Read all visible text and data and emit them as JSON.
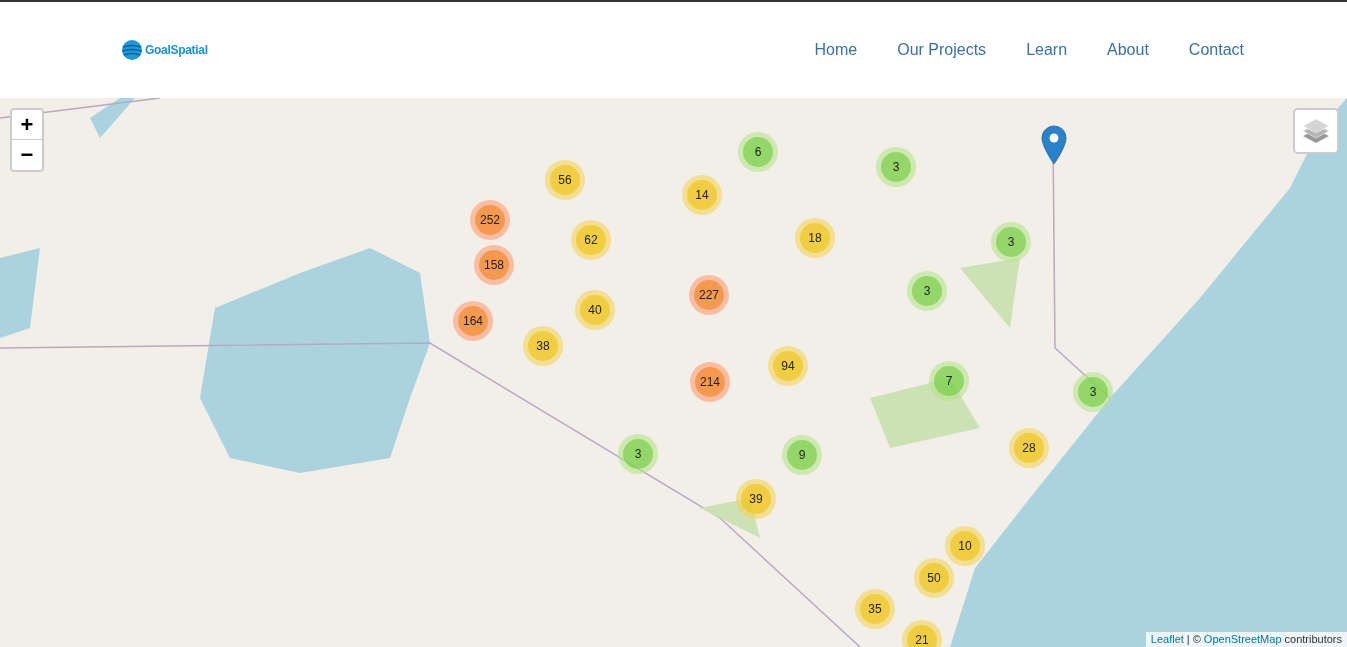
{
  "header": {
    "logo_text": "GoalSpatial",
    "nav": [
      {
        "label": "Home"
      },
      {
        "label": "Our Projects"
      },
      {
        "label": "Learn"
      },
      {
        "label": "About"
      },
      {
        "label": "Contact"
      }
    ]
  },
  "map": {
    "zoom_controls": [
      "+",
      "−"
    ],
    "clusters": [
      {
        "count": "6",
        "kind": "small"
      },
      {
        "count": "3",
        "kind": "small"
      },
      {
        "count": "56",
        "kind": "medium"
      },
      {
        "count": "14",
        "kind": "medium"
      },
      {
        "count": "252",
        "kind": "large"
      },
      {
        "count": "62",
        "kind": "medium"
      },
      {
        "count": "18",
        "kind": "medium"
      },
      {
        "count": "3",
        "kind": "small"
      },
      {
        "count": "158",
        "kind": "large"
      },
      {
        "count": "227",
        "kind": "large"
      },
      {
        "count": "3",
        "kind": "small"
      },
      {
        "count": "40",
        "kind": "medium"
      },
      {
        "count": "164",
        "kind": "large"
      },
      {
        "count": "38",
        "kind": "medium"
      },
      {
        "count": "94",
        "kind": "medium"
      },
      {
        "count": "214",
        "kind": "large"
      },
      {
        "count": "7",
        "kind": "small"
      },
      {
        "count": "3",
        "kind": "small"
      },
      {
        "count": "28",
        "kind": "medium"
      },
      {
        "count": "3",
        "kind": "small"
      },
      {
        "count": "9",
        "kind": "small"
      },
      {
        "count": "39",
        "kind": "medium"
      },
      {
        "count": "10",
        "kind": "medium"
      },
      {
        "count": "50",
        "kind": "medium"
      },
      {
        "count": "35",
        "kind": "medium"
      },
      {
        "count": "21",
        "kind": "medium"
      }
    ],
    "attribution": {
      "leaflet_link": "Leaflet",
      "separator": "| ©",
      "osm_link": "OpenStreetMap",
      "suffix": "contributors"
    }
  }
}
